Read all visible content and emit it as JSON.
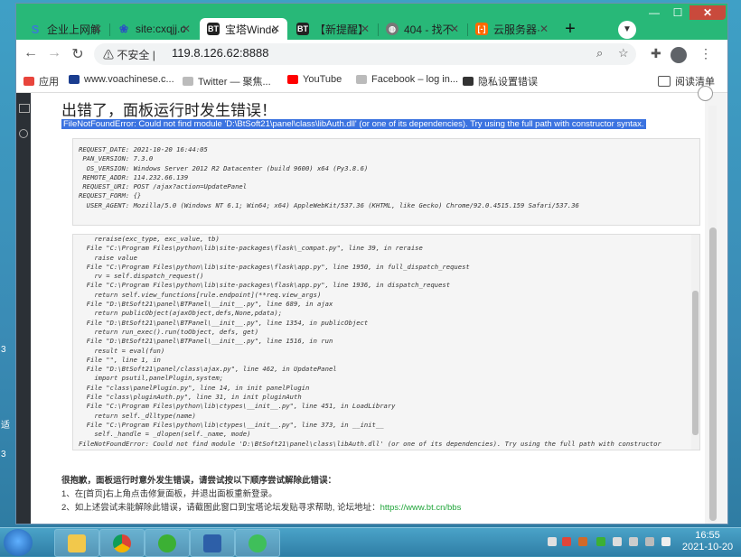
{
  "browser": {
    "tabs": [
      {
        "title": "企业上网解",
        "icon_color": "#3a7bd5",
        "icon": "s-icon"
      },
      {
        "title": "site:cxqjj.c",
        "icon_color": "#2b4ec8",
        "icon": "paw-icon"
      },
      {
        "title": "宝塔Windo",
        "icon_color": "#222222",
        "icon": "bt-icon",
        "active": true
      },
      {
        "title": "【新提醒】",
        "icon_color": "#222222",
        "icon": "bt-icon"
      },
      {
        "title": "404 - 找不",
        "icon_color": "#666666",
        "icon": "globe-icon"
      },
      {
        "title": "云服务器·",
        "icon_color": "#ff6a00",
        "icon": "aliyun-icon"
      }
    ],
    "not_secure_label": "不安全",
    "url": "119.8.126.62:8888",
    "bookmarks": [
      {
        "label": "应用",
        "color": "#e8453c"
      },
      {
        "label": "www.voachinese.c...",
        "color": "#1a3d8f"
      },
      {
        "label": "Twitter — 聚焦...",
        "color": "#bbbbbb"
      },
      {
        "label": "YouTube",
        "color": "#ff0000"
      },
      {
        "label": "Facebook – log in...",
        "color": "#bbbbbb"
      },
      {
        "label": "隐私设置错误",
        "color": "#333333"
      }
    ],
    "reading_list_label": "阅读清单"
  },
  "error_page": {
    "title": "出错了，面板运行时发生错误！",
    "error_line": "FileNotFoundError: Could not find module 'D:\\BtSoft21\\panel\\class\\libAuth.dll' (or one of its dependencies). Try using the full path with constructor syntax.",
    "request_info": "REQUEST_DATE: 2021-10-20 16:44:05\n PAN_VERSION: 7.3.0\n  OS_VERSION: Windows Server 2012 R2 Datacenter (build 9600) x64 (Py3.8.6)\n REMOTE_ADDR: 114.232.66.139\n REQUEST_URI: POST /ajax?action=UpdatePanel\nREQUEST_FORM: {}\n  USER_AGENT: Mozilla/5.0 (Windows NT 6.1; Win64; x64) AppleWebKit/537.36 (KHTML, like Gecko) Chrome/92.0.4515.159 Safari/537.36",
    "traceback": "    reraise(exc_type, exc_value, tb)\n  File \"C:\\Program Files\\python\\lib\\site-packages\\flask\\_compat.py\", line 39, in reraise\n    raise value\n  File \"C:\\Program Files\\python\\lib\\site-packages\\flask\\app.py\", line 1950, in full_dispatch_request\n    rv = self.dispatch_request()\n  File \"C:\\Program Files\\python\\lib\\site-packages\\flask\\app.py\", line 1936, in dispatch_request\n    return self.view_functions[rule.endpoint](**req.view_args)\n  File \"D:\\BtSoft21\\panel\\BTPanel\\__init__.py\", line 689, in ajax\n    return publicObject(ajaxObject,defs,None,pdata);\n  File \"D:\\BtSoft21\\panel\\BTPanel\\__init__.py\", line 1354, in publicObject\n    return run_exec().run(toObject, defs, get)\n  File \"D:\\BtSoft21\\panel\\BTPanel\\__init__.py\", line 1516, in run\n    result = eval(fun)\n  File \"\", line 1, in\n  File \"D:\\BtSoft21\\panel/class\\ajax.py\", line 462, in UpdatePanel\n    import psutil,panelPlugin,system;\n  File \"class\\panelPlugin.py\", line 14, in init panelPlugin\n  File \"class\\pluginAuth.py\", line 31, in init pluginAuth\n  File \"C:\\Program Files\\python\\lib\\ctypes\\__init__.py\", line 451, in LoadLibrary\n    return self._dlltype(name)\n  File \"C:\\Program Files\\python\\lib\\ctypes\\__init__.py\", line 373, in __init__\n    self._handle = _dlopen(self._name, mode)\nFileNotFoundError: Could not find module 'D:\\BtSoft21\\panel\\class\\libAuth.dll' (or one of its dependencies). Try using the full path with constructor syntax.",
    "help_heading": "很抱歉，面板运行时意外发生错误，请尝试按以下顺序尝试解除此错误：",
    "help_step1": "1、在[首页]右上角点击修复面板，并退出面板重新登录。",
    "help_step2": "2、如上述尝试未能解除此错误，请截图此窗口到宝塔论坛发贴寻求帮助, 论坛地址：",
    "help_link": "https://www.bt.cn/bbs"
  },
  "taskbar": {
    "time": "16:55",
    "date": "2021-10-20"
  }
}
